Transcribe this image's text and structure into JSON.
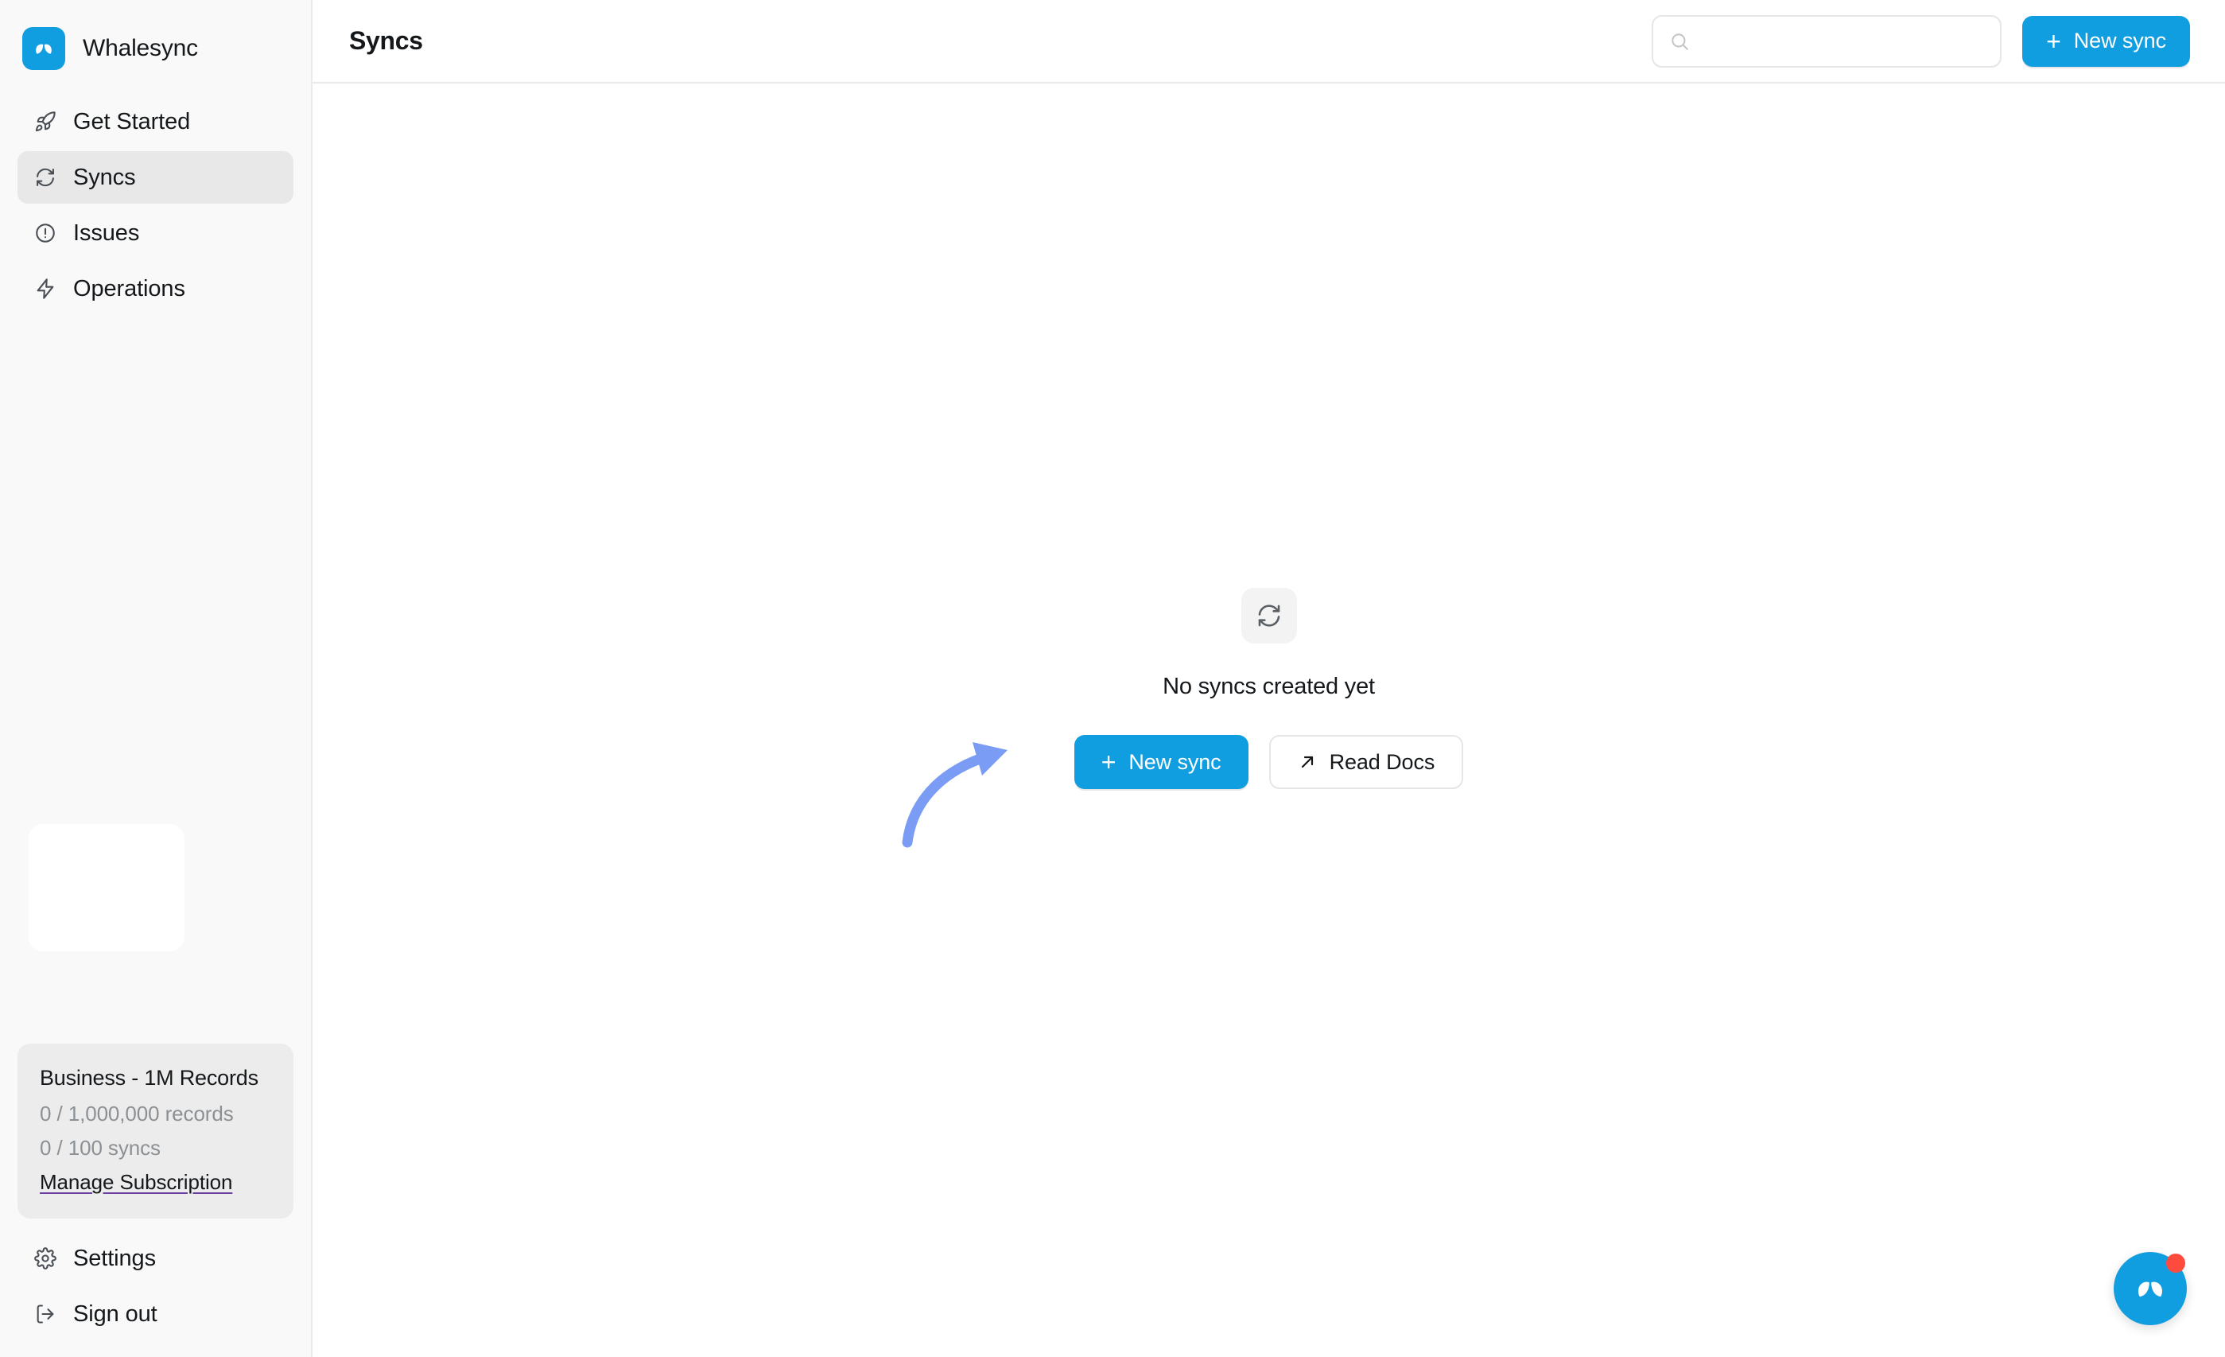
{
  "brand": {
    "name": "Whalesync",
    "logo_icon": "whale-tail-logo-icon",
    "accent_color": "#119ee0"
  },
  "sidebar": {
    "nav_items": [
      {
        "label": "Get Started",
        "icon": "rocket-icon",
        "active": false
      },
      {
        "label": "Syncs",
        "icon": "refresh-icon",
        "active": true
      },
      {
        "label": "Issues",
        "icon": "alert-circle-icon",
        "active": false
      },
      {
        "label": "Operations",
        "icon": "lightning-bolt-icon",
        "active": false
      }
    ],
    "plan_card": {
      "title": "Business - 1M Records",
      "records_usage": "0 / 1,000,000 records",
      "syncs_usage": "0 / 100 syncs",
      "manage_link": "Manage Subscription",
      "link_underline_color": "#6b3fa0"
    },
    "footer_items": [
      {
        "label": "Settings",
        "icon": "gear-icon"
      },
      {
        "label": "Sign out",
        "icon": "logout-icon"
      }
    ]
  },
  "header": {
    "title": "Syncs",
    "search": {
      "value": "",
      "placeholder": "",
      "icon": "search-icon"
    },
    "new_sync_button": {
      "label": "New sync",
      "plus": "+",
      "color": "#119ee0"
    }
  },
  "empty_state": {
    "icon": "refresh-icon",
    "title": "No syncs created yet",
    "primary_button": {
      "label": "New sync",
      "plus": "+"
    },
    "secondary_button": {
      "label": "Read Docs",
      "icon": "arrow-up-right-icon"
    },
    "annotation_arrow": {
      "icon": "curved-arrow-icon",
      "color": "#7a9cf5"
    }
  },
  "chat_widget": {
    "icon": "whale-tail-logo-icon",
    "badge_color": "#ff4b3e",
    "background_color": "#119ee0"
  }
}
